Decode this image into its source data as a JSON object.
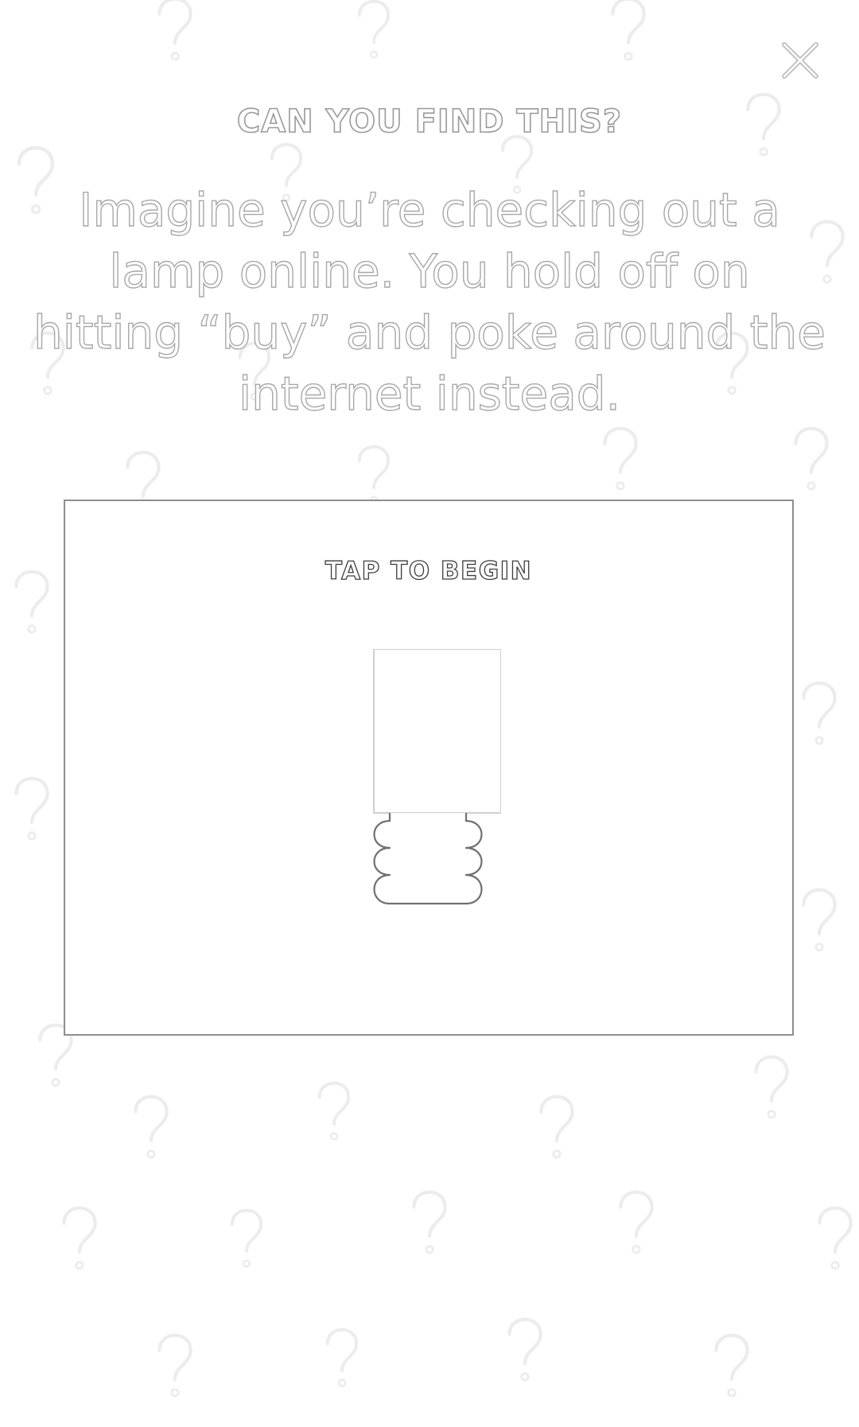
{
  "header": {
    "eyebrow": "CAN YOU FIND THIS?",
    "intro": "Imagine you’re checking out a lamp online. You hold off on hitting “buy” and poke around the internet instead."
  },
  "card": {
    "tap_label": "TAP TO BEGIN"
  },
  "icons": {
    "close": "close-icon",
    "background": "question-mark-icon",
    "illustration": "phone-with-hand-icon"
  },
  "colors": {
    "background": "#ffffff",
    "outline": "#9a9a9a",
    "card_border": "#8e8e8e"
  }
}
